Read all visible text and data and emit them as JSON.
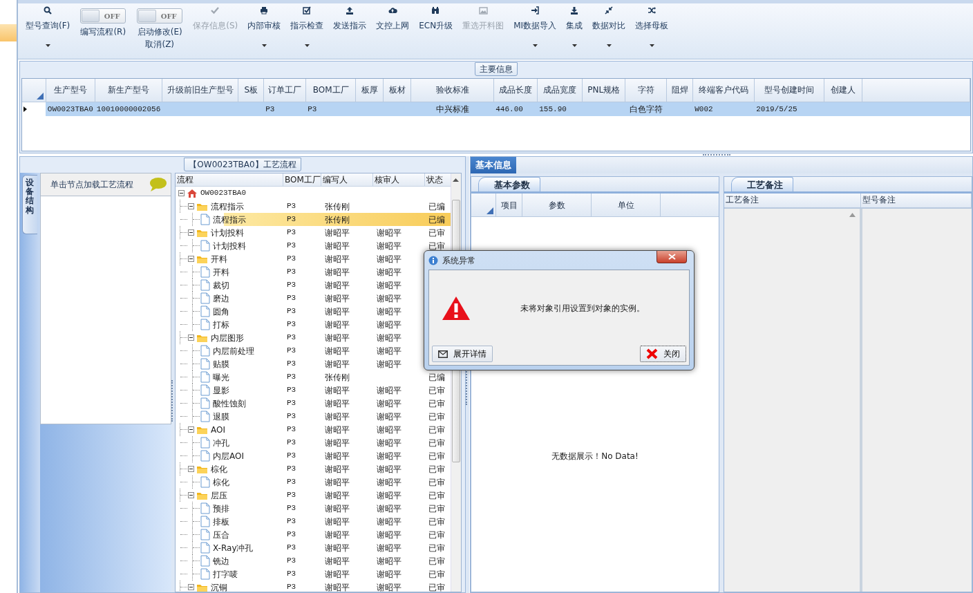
{
  "toolbar": {
    "items": [
      {
        "kind": "button",
        "label": "型号查询(F)",
        "disabled": false,
        "dropdown": true
      },
      {
        "kind": "toggle",
        "toggle_text": "OFF",
        "on": false,
        "label": "编写流程(R)"
      },
      {
        "kind": "toggle",
        "toggle_text": "OFF",
        "on": false,
        "label": "启动修改(E)",
        "label_2": "取消(Z)"
      },
      {
        "kind": "button",
        "label": "保存信息(S)",
        "disabled": true,
        "dropdown": false
      },
      {
        "kind": "button",
        "label": "内部审核",
        "disabled": false,
        "dropdown": true
      },
      {
        "kind": "button",
        "label": "指示检查",
        "disabled": false,
        "dropdown": true
      },
      {
        "kind": "button",
        "label": "发送指示",
        "disabled": false,
        "dropdown": false
      },
      {
        "kind": "button",
        "label": "文控上网",
        "disabled": false,
        "dropdown": false
      },
      {
        "kind": "button",
        "label": "ECN升级",
        "disabled": false,
        "dropdown": false
      },
      {
        "kind": "button",
        "label": "重选开料图",
        "disabled": true,
        "dropdown": false
      },
      {
        "kind": "button",
        "label": "MI数据导入",
        "disabled": false,
        "dropdown": true
      },
      {
        "kind": "button",
        "label": "集成",
        "disabled": false,
        "dropdown": true
      },
      {
        "kind": "button",
        "label": "数据对比",
        "disabled": false,
        "dropdown": true
      },
      {
        "kind": "button",
        "label": "选择母板",
        "disabled": false,
        "dropdown": true
      }
    ]
  },
  "main_info": {
    "title": "主要信息",
    "columns": [
      "生产型号",
      "新生产型号",
      "升级前旧生产型号",
      "S板",
      "订单工厂",
      "BOM工厂",
      "板厚",
      "板材",
      "验收标准",
      "成品长度",
      "成品宽度",
      "PNL规格",
      "字符",
      "阻焊",
      "终端客户代码",
      "型号创建时间",
      "创建人"
    ],
    "rows": [
      {
        "selected": true,
        "cells": [
          "OW0023TBA0",
          "10010000002056",
          null,
          null,
          "P3",
          "P3",
          null,
          null,
          "中兴标准",
          "446.00",
          "155.90",
          null,
          "白色字符",
          null,
          "W002",
          "2019/5/25",
          null
        ]
      }
    ]
  },
  "process": {
    "title": "【OW0023TBA0】工艺流程",
    "vertical_tab": {
      "label": "设备结构",
      "selected": true
    },
    "hint": "单击节点加载工艺流程",
    "columns": [
      "流程",
      "BOM工厂",
      "编写人",
      "核审人",
      "状态"
    ],
    "nodes": [
      {
        "kind": "root",
        "label": "OW0023TBA0",
        "expanded": true,
        "selected": false,
        "children": [
          {
            "kind": "folder",
            "label": "流程指示",
            "bom": "P3",
            "writer": "张传刚",
            "status": "已编",
            "expanded": true,
            "selected": false,
            "children": [
              {
                "kind": "doc",
                "label": "流程指示",
                "bom": "P3",
                "writer": "张传刚",
                "status": "已编",
                "selected": true
              }
            ]
          },
          {
            "kind": "folder",
            "label": "计划投料",
            "bom": "P3",
            "writer": "谢昭平",
            "reviewer": "谢昭平",
            "status": "已审",
            "expanded": true,
            "selected": false,
            "children": [
              {
                "kind": "doc",
                "label": "计划投料",
                "bom": "P3",
                "writer": "谢昭平",
                "reviewer": "谢昭平",
                "status": "已审",
                "selected": false
              }
            ]
          },
          {
            "kind": "folder",
            "label": "开料",
            "bom": "P3",
            "writer": "谢昭平",
            "reviewer": "谢昭平",
            "expanded": true,
            "selected": false,
            "children": [
              {
                "kind": "doc",
                "label": "开料",
                "bom": "P3",
                "writer": "谢昭平",
                "reviewer": "谢昭平",
                "selected": false
              },
              {
                "kind": "doc",
                "label": "裁切",
                "bom": "P3",
                "writer": "谢昭平",
                "reviewer": "谢昭平",
                "selected": false
              },
              {
                "kind": "doc",
                "label": "磨边",
                "bom": "P3",
                "writer": "谢昭平",
                "reviewer": "谢昭平",
                "selected": false
              },
              {
                "kind": "doc",
                "label": "圆角",
                "bom": "P3",
                "writer": "谢昭平",
                "reviewer": "谢昭平",
                "selected": false
              },
              {
                "kind": "doc",
                "label": "打标",
                "bom": "P3",
                "writer": "谢昭平",
                "reviewer": "谢昭平",
                "selected": false
              }
            ]
          },
          {
            "kind": "folder",
            "label": "内层图形",
            "bom": "P3",
            "writer": "谢昭平",
            "reviewer": "谢昭平",
            "expanded": true,
            "selected": false,
            "children": [
              {
                "kind": "doc",
                "label": "内层前处理",
                "bom": "P3",
                "writer": "谢昭平",
                "reviewer": "谢昭平",
                "selected": false
              },
              {
                "kind": "doc",
                "label": "贴膜",
                "bom": "P3",
                "writer": "谢昭平",
                "reviewer": "谢昭平",
                "selected": false
              },
              {
                "kind": "doc",
                "label": "曝光",
                "bom": "P3",
                "writer": "张传刚",
                "status": "已编",
                "selected": false
              },
              {
                "kind": "doc",
                "label": "显影",
                "bom": "P3",
                "writer": "谢昭平",
                "reviewer": "谢昭平",
                "status": "已审",
                "selected": false
              },
              {
                "kind": "doc",
                "label": "酸性蚀刻",
                "bom": "P3",
                "writer": "谢昭平",
                "reviewer": "谢昭平",
                "status": "已审",
                "selected": false
              },
              {
                "kind": "doc",
                "label": "退膜",
                "bom": "P3",
                "writer": "谢昭平",
                "reviewer": "谢昭平",
                "status": "已审",
                "selected": false
              }
            ]
          },
          {
            "kind": "folder",
            "label": "AOI",
            "bom": "P3",
            "writer": "谢昭平",
            "reviewer": "谢昭平",
            "status": "已审",
            "expanded": true,
            "selected": false,
            "children": [
              {
                "kind": "doc",
                "label": "冲孔",
                "bom": "P3",
                "writer": "谢昭平",
                "reviewer": "谢昭平",
                "status": "已审",
                "selected": false
              },
              {
                "kind": "doc",
                "label": "内层AOI",
                "bom": "P3",
                "writer": "谢昭平",
                "reviewer": "谢昭平",
                "status": "已审",
                "selected": false
              }
            ]
          },
          {
            "kind": "folder",
            "label": "棕化",
            "bom": "P3",
            "writer": "谢昭平",
            "reviewer": "谢昭平",
            "status": "已审",
            "expanded": true,
            "selected": false,
            "children": [
              {
                "kind": "doc",
                "label": "棕化",
                "bom": "P3",
                "writer": "谢昭平",
                "reviewer": "谢昭平",
                "status": "已审",
                "selected": false
              }
            ]
          },
          {
            "kind": "folder",
            "label": "层压",
            "bom": "P3",
            "writer": "谢昭平",
            "reviewer": "谢昭平",
            "status": "已审",
            "expanded": true,
            "selected": false,
            "children": [
              {
                "kind": "doc",
                "label": "预排",
                "bom": "P3",
                "writer": "谢昭平",
                "reviewer": "谢昭平",
                "status": "已审",
                "selected": false
              },
              {
                "kind": "doc",
                "label": "排板",
                "bom": "P3",
                "writer": "谢昭平",
                "reviewer": "谢昭平",
                "status": "已审",
                "selected": false
              },
              {
                "kind": "doc",
                "label": "压合",
                "bom": "P3",
                "writer": "谢昭平",
                "reviewer": "谢昭平",
                "status": "已审",
                "selected": false
              },
              {
                "kind": "doc",
                "label": "X-Ray冲孔",
                "bom": "P3",
                "writer": "谢昭平",
                "reviewer": "谢昭平",
                "status": "已审",
                "selected": false
              },
              {
                "kind": "doc",
                "label": "铣边",
                "bom": "P3",
                "writer": "谢昭平",
                "reviewer": "谢昭平",
                "status": "已审",
                "selected": false
              },
              {
                "kind": "doc",
                "label": "打字唛",
                "bom": "P3",
                "writer": "谢昭平",
                "reviewer": "谢昭平",
                "status": "已审",
                "selected": false
              }
            ]
          },
          {
            "kind": "folder",
            "label": "沉铜",
            "bom": "P3",
            "writer": "谢昭平",
            "reviewer": "谢昭平",
            "status": "已审",
            "expanded": true,
            "selected": false
          }
        ]
      }
    ]
  },
  "detail": {
    "tabs": [
      {
        "label": "基本信息",
        "selected": true
      }
    ],
    "params": {
      "tabs": [
        {
          "label": "基本参数",
          "selected": true
        }
      ],
      "columns": [
        "项目",
        "参数",
        "单位"
      ],
      "empty_text": "无数据展示！No Data!"
    },
    "notes": {
      "tabs": [
        {
          "label": "工艺备注",
          "selected": true
        }
      ],
      "columns": [
        "工艺备注",
        "型号备注"
      ]
    }
  },
  "dialog": {
    "title": "系统异常",
    "message": "未将对象引用设置到对象的实例。",
    "buttons": [
      {
        "kind": "details",
        "label": "展开详情",
        "focused": false
      },
      {
        "kind": "close",
        "label": "关闭",
        "focused": true
      }
    ]
  }
}
